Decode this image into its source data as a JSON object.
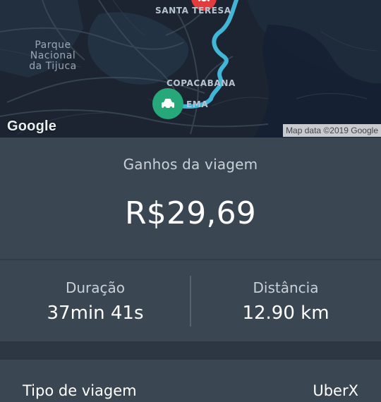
{
  "map": {
    "labels": {
      "park": "Parque\nNacional\nda Tijuca",
      "santa_teresa": "SANTA TERESA",
      "copacabana": "COPACABANA",
      "ipanema_partial": "EMA"
    },
    "google": "Google",
    "attribution": "Map data ©2019 Google",
    "pickup_icon": "car-icon",
    "dropoff_icon": "car-icon",
    "colors": {
      "route": "#41b6d7",
      "pickup": "#e23c3c",
      "dropoff": "#26a87a"
    }
  },
  "earnings": {
    "label": "Ganhos da viagem",
    "value": "R$29,69"
  },
  "stats": {
    "duration_label": "Duração",
    "duration_value": "37min 41s",
    "distance_label": "Distância",
    "distance_value": "12.90 km"
  },
  "trip": {
    "type_label": "Tipo de viagem",
    "type_value": "UberX"
  }
}
